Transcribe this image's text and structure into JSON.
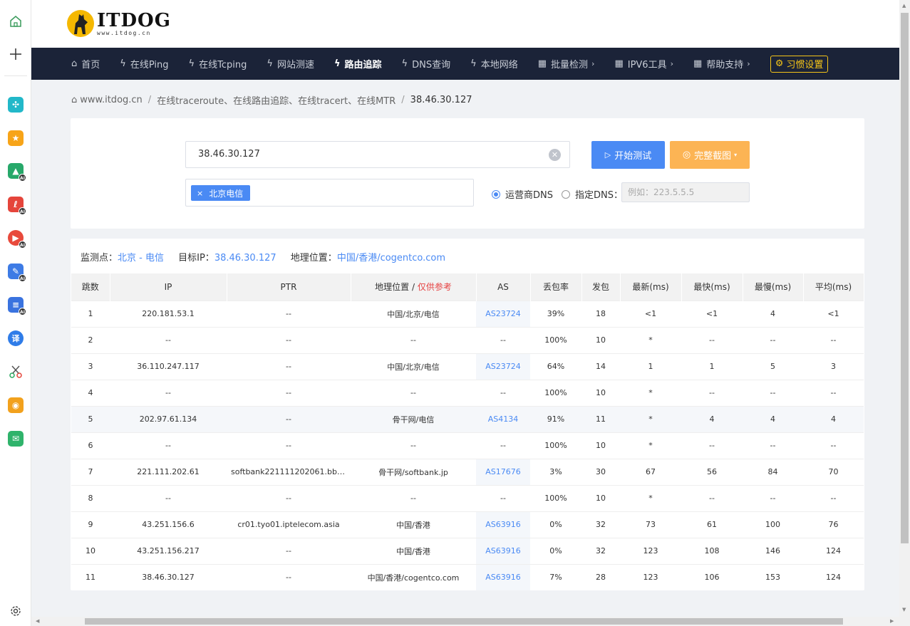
{
  "sidebar": {
    "icons": [
      "home-icon",
      "plus-icon",
      "puzzle-icon",
      "star-icon",
      "image-ai-icon",
      "pdf-ai-icon",
      "video-ai-icon",
      "edit-ai-icon",
      "doc-ai-icon",
      "translate-icon",
      "scissors-icon",
      "weibo-icon",
      "mail-icon",
      "settings-icon"
    ],
    "translate_glyph": "译"
  },
  "logo": {
    "main": "ITDOG",
    "sub": "www.itdog.cn"
  },
  "nav": {
    "items": [
      {
        "icon": "⌂",
        "label": "首页"
      },
      {
        "icon": "ϟ",
        "label": "在线Ping"
      },
      {
        "icon": "ϟ",
        "label": "在线Tcping"
      },
      {
        "icon": "ϟ",
        "label": "网站测速"
      },
      {
        "icon": "ϟ",
        "label": "路由追踪"
      },
      {
        "icon": "ϟ",
        "label": "DNS查询"
      },
      {
        "icon": "ϟ",
        "label": "本地网络"
      },
      {
        "icon": "▦",
        "label": "批量检测"
      },
      {
        "icon": "▦",
        "label": "IPV6工具"
      },
      {
        "icon": "▦",
        "label": "帮助支持"
      }
    ],
    "settings_label": "习惯设置"
  },
  "breadcrumb": {
    "home": "www.itdog.cn",
    "section": "在线traceroute、在线路由追踪、在线tracert、在线MTR",
    "current": "38.46.30.127"
  },
  "search": {
    "ip_value": "38.46.30.127",
    "start_label": "开始测试",
    "screenshot_label": "完整截图",
    "node_tag": "北京电信",
    "dns_option1": "运营商DNS",
    "dns_option2": "指定DNS：",
    "dns_placeholder": "例如：223.5.5.5"
  },
  "info": {
    "node_label": "监测点：",
    "node_value": "北京 - 电信",
    "target_label": "目标IP：",
    "target_value": "38.46.30.127",
    "geo_label": "地理位置：",
    "geo_value": "中国/香港/cogentco.com"
  },
  "table": {
    "headers": [
      "跳数",
      "IP",
      "PTR",
      "地理位置 / ",
      "AS",
      "丢包率",
      "发包",
      "最新(ms)",
      "最快(ms)",
      "最慢(ms)",
      "平均(ms)"
    ],
    "geo_ref": "仅供参考",
    "rows": [
      [
        "1",
        "220.181.53.1",
        "--",
        "中国/北京/电信",
        "AS23724",
        "39%",
        "18",
        "<1",
        "<1",
        "4",
        "<1"
      ],
      [
        "2",
        "--",
        "--",
        "--",
        "--",
        "100%",
        "10",
        "*",
        "--",
        "--",
        "--"
      ],
      [
        "3",
        "36.110.247.117",
        "--",
        "中国/北京/电信",
        "AS23724",
        "64%",
        "14",
        "1",
        "1",
        "5",
        "3"
      ],
      [
        "4",
        "--",
        "--",
        "--",
        "--",
        "100%",
        "10",
        "*",
        "--",
        "--",
        "--"
      ],
      [
        "5",
        "202.97.61.134",
        "--",
        "骨干网/电信",
        "AS4134",
        "91%",
        "11",
        "*",
        "4",
        "4",
        "4"
      ],
      [
        "6",
        "--",
        "--",
        "--",
        "--",
        "100%",
        "10",
        "*",
        "--",
        "--",
        "--"
      ],
      [
        "7",
        "221.111.202.61",
        "softbank221111202061.bbte...",
        "骨干网/softbank.jp",
        "AS17676",
        "3%",
        "30",
        "67",
        "56",
        "84",
        "70"
      ],
      [
        "8",
        "--",
        "--",
        "--",
        "--",
        "100%",
        "10",
        "*",
        "--",
        "--",
        "--"
      ],
      [
        "9",
        "43.251.156.6",
        "cr01.tyo01.iptelecom.asia",
        "中国/香港",
        "AS63916",
        "0%",
        "32",
        "73",
        "61",
        "100",
        "76"
      ],
      [
        "10",
        "43.251.156.217",
        "--",
        "中国/香港",
        "AS63916",
        "0%",
        "32",
        "123",
        "108",
        "146",
        "124"
      ],
      [
        "11",
        "38.46.30.127",
        "--",
        "中国/香港/cogentco.com",
        "AS63916",
        "7%",
        "28",
        "123",
        "106",
        "153",
        "124"
      ]
    ]
  }
}
